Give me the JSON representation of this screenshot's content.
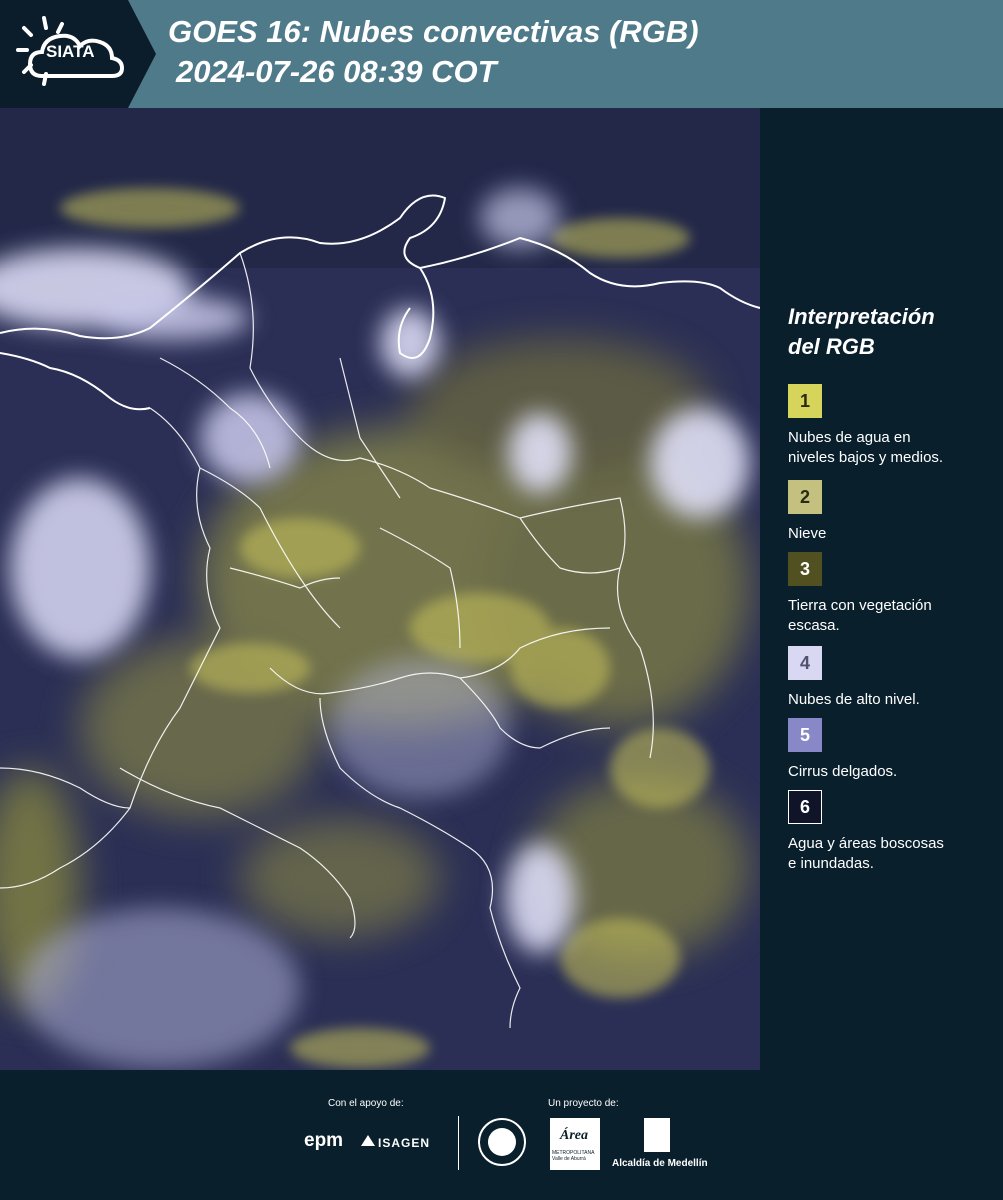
{
  "header": {
    "logo_text": "SIATA",
    "title_line1": "GOES 16: Nubes convectivas (RGB)",
    "title_line2": "2024-07-26 08:39 COT"
  },
  "legend": {
    "title_line1": "Interpretación",
    "title_line2": "del RGB",
    "items": [
      {
        "number": "1",
        "label_line1": "Nubes de agua en",
        "label_line2": "niveles bajos y medios.",
        "color": "#d6d45a",
        "text_color": "#2a2a10"
      },
      {
        "number": "2",
        "label_line1": "Nieve",
        "label_line2": "",
        "color": "#c3c080",
        "text_color": "#2a2a10"
      },
      {
        "number": "3",
        "label_line1": "Tierra con vegetación",
        "label_line2": "escasa.",
        "color": "#505020",
        "text_color": "#ffffff"
      },
      {
        "number": "4",
        "label_line1": "Nubes de alto nivel.",
        "label_line2": "",
        "color": "#d8d8f2",
        "text_color": "#505070"
      },
      {
        "number": "5",
        "label_line1": "Cirrus delgados.",
        "label_line2": "",
        "color": "#8888c8",
        "text_color": "#ffffff"
      },
      {
        "number": "6",
        "label_line1": "Agua y áreas boscosas",
        "label_line2": "e inundadas.",
        "color": "#101428",
        "text_color": "#ffffff"
      }
    ]
  },
  "footer": {
    "support_label": "Con el apoyo de:",
    "project_label": "Un proyecto de:",
    "epm": "epm",
    "isagen": "ISAGEN",
    "area_text": "Área",
    "area_sub": "METROPOLITANA Valle de Aburrá",
    "alcaldia": "Alcaldía de Medellín"
  },
  "colors": {
    "header_bg": "#4f7a8a",
    "panel_bg": "#0a1f2c",
    "cloud_high": "#d8d8f2",
    "cloud_low": "#d6d45a",
    "ground": "#2b2f55",
    "borders": "#ffffff"
  }
}
